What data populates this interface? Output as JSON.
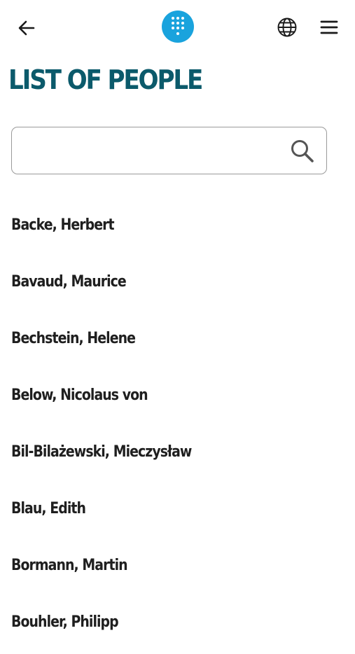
{
  "header": {
    "back_icon": "arrow-left-icon",
    "logo_icon": "dialpad-dots-icon",
    "language_icon": "globe-icon",
    "menu_icon": "hamburger-menu-icon"
  },
  "colors": {
    "title": "#0b5a6b",
    "logo_bg": "#1aa3dd",
    "text": "#1f1f1f",
    "search_border": "#9a9a9a"
  },
  "page": {
    "title": "LIST OF PEOPLE"
  },
  "search": {
    "value": "",
    "placeholder": "",
    "icon": "search-icon"
  },
  "people": [
    {
      "name": "Backe, Herbert"
    },
    {
      "name": "Bavaud, Maurice"
    },
    {
      "name": "Bechstein, Helene"
    },
    {
      "name": "Below, Nicolaus von"
    },
    {
      "name": "Bil-Bilażewski, Mieczysław"
    },
    {
      "name": "Blau, Edith"
    },
    {
      "name": "Bormann, Martin"
    },
    {
      "name": "Bouhler, Philipp"
    }
  ]
}
